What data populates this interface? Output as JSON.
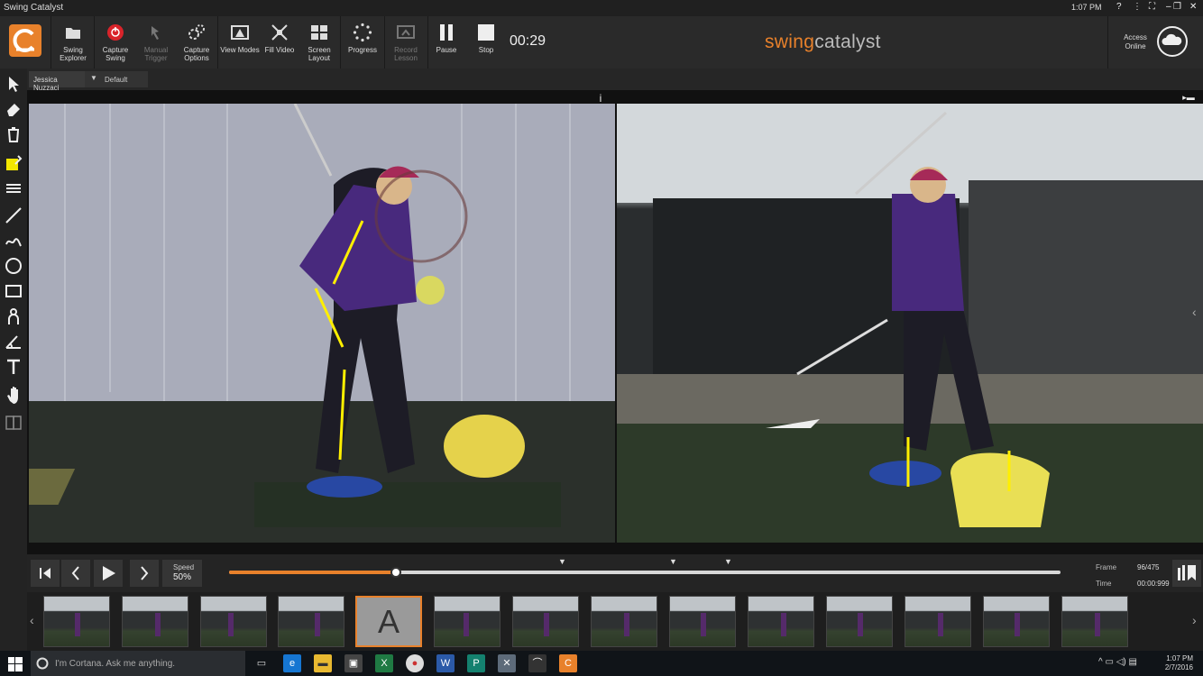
{
  "window": {
    "title": "Swing Catalyst",
    "time": "1:07 PM",
    "controls": [
      "?",
      "⋮",
      "⛶",
      "–",
      "❐",
      "✕"
    ]
  },
  "toolbar": {
    "buttons": [
      {
        "label": "Swing Explorer",
        "icon": "folder-icon"
      },
      {
        "label": "Capture Swing",
        "icon": "record-icon"
      },
      {
        "label": "Manual Trigger",
        "icon": "trigger-icon"
      },
      {
        "label": "Capture Options",
        "icon": "gears-icon"
      },
      {
        "label": "View Modes",
        "icon": "view-modes-icon"
      },
      {
        "label": "Fill Video",
        "icon": "fill-video-icon"
      },
      {
        "label": "Screen Layout",
        "icon": "layout-icon"
      },
      {
        "label": "Progress",
        "icon": "progress-spinner-icon"
      },
      {
        "label": "Record Lesson",
        "icon": "record-lesson-icon"
      },
      {
        "label": "Pause",
        "icon": "pause-icon"
      },
      {
        "label": "Stop",
        "icon": "stop-icon"
      }
    ],
    "timer": "00:29",
    "brand_prefix": "swing",
    "brand_suffix": "catalyst",
    "access_line1": "Access",
    "access_line2": "Online"
  },
  "tabs": {
    "user": "Jessica Nuzzaci",
    "profile": "Default"
  },
  "playback": {
    "speed_label": "Speed",
    "speed_value": "50%",
    "progress": 0.2,
    "frame_label": "Frame",
    "frame_value": "96/475",
    "time_label": "Time",
    "time_value": "00:00:999"
  },
  "taskbar": {
    "search_placeholder": "I'm Cortana. Ask me anything.",
    "time": "1:07 PM",
    "date": "2/7/2016"
  },
  "colors": {
    "accent": "#e8812b"
  }
}
